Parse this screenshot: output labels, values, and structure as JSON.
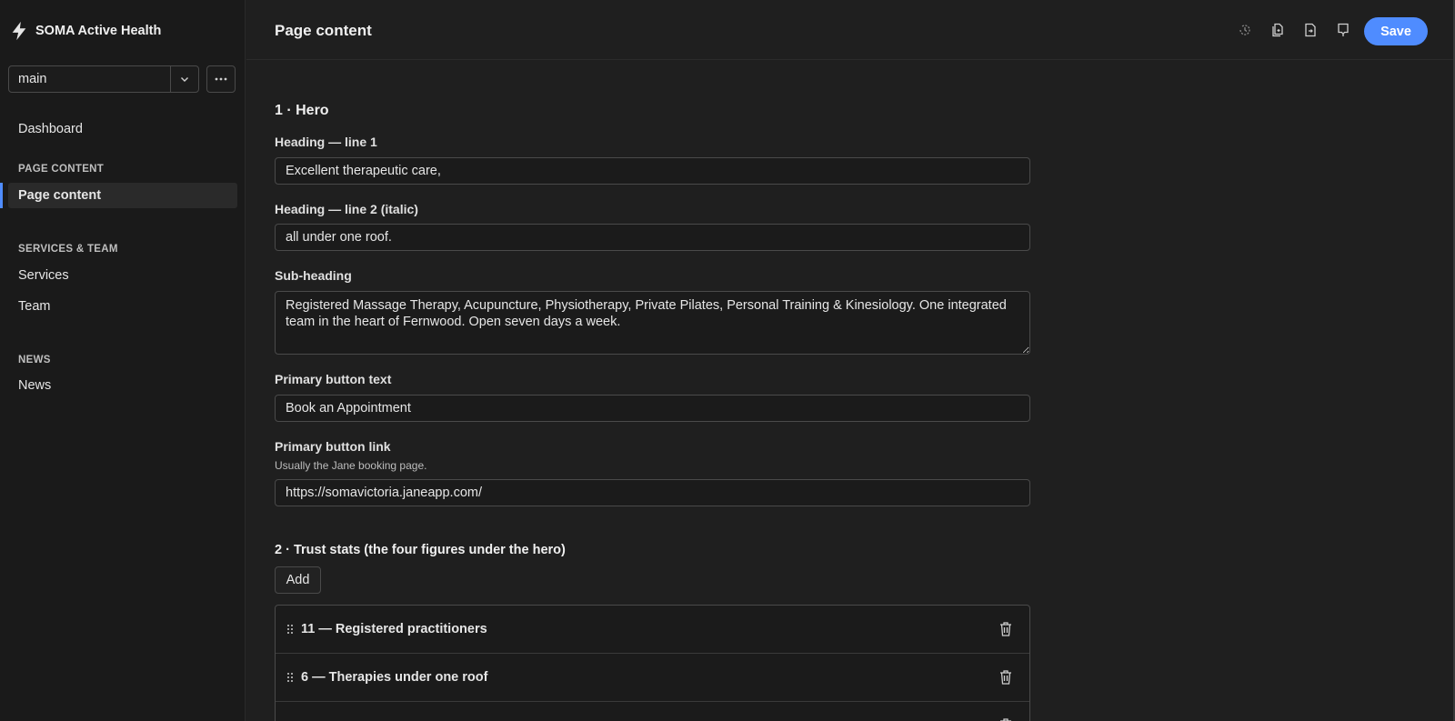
{
  "app": {
    "brand": "SOMA Active Health"
  },
  "sidebar": {
    "branch": "main",
    "items": [
      {
        "label": "Dashboard"
      }
    ],
    "groups": [
      {
        "heading": "Page content",
        "items": [
          {
            "label": "Page content",
            "active": true
          }
        ]
      },
      {
        "heading": "Services & Team",
        "items": [
          {
            "label": "Services"
          },
          {
            "label": "Team"
          }
        ]
      },
      {
        "heading": "News",
        "items": [
          {
            "label": "News"
          }
        ]
      }
    ]
  },
  "topbar": {
    "title": "Page content",
    "icons": [
      "history-icon",
      "duplicate-icon",
      "preview-icon",
      "publish-icon"
    ],
    "save_label": "Save",
    "accent_color": "#4f8cff"
  },
  "hero": {
    "title": "1 · Hero",
    "heading1": {
      "label": "Heading — line 1",
      "value": "Excellent therapeutic care,"
    },
    "heading2": {
      "label": "Heading — line 2 (italic)",
      "value": "all under one roof."
    },
    "subheading": {
      "label": "Sub-heading",
      "value": "Registered Massage Therapy, Acupuncture, Physiotherapy, Private Pilates, Personal Training & Kinesiology. One integrated team in the heart of Fernwood. Open seven days a week."
    },
    "button_text": {
      "label": "Primary button text",
      "value": "Book an Appointment"
    },
    "button_link": {
      "label": "Primary button link",
      "help": "Usually the Jane booking page.",
      "value": "https://somavictoria.janeapp.com/"
    }
  },
  "stats": {
    "title": "2 · Trust stats (the four figures under the hero)",
    "add_label": "Add",
    "items": [
      {
        "label": "11 — Registered practitioners"
      },
      {
        "label": "6 — Therapies under one roof"
      }
    ]
  }
}
